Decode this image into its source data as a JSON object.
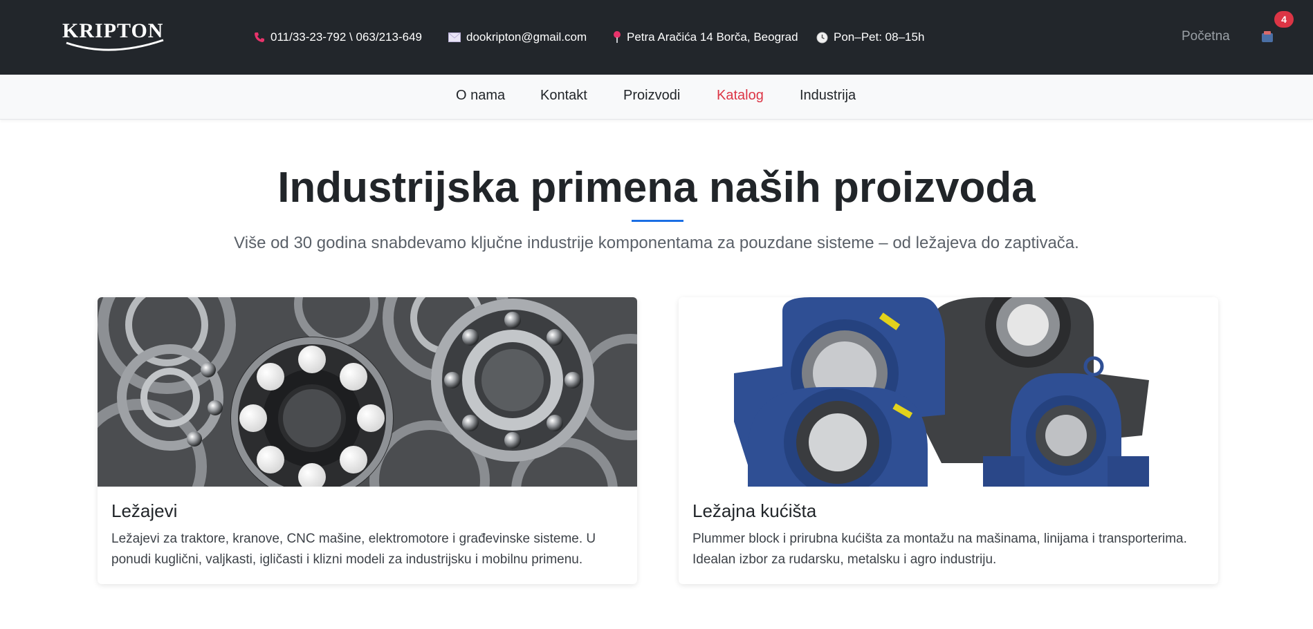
{
  "brand": {
    "logo_text": "KRIPTON"
  },
  "topbar": {
    "phone": "011/33-23-792 \\ 063/213-649",
    "email": "dookripton@gmail.com",
    "address": "Petra Aračića 14 Borča, Beograd",
    "hours": "Pon–Pet: 08–15h",
    "home_link": "Početna",
    "cart_count": "4"
  },
  "nav": {
    "items": [
      {
        "label": "O nama"
      },
      {
        "label": "Kontakt"
      },
      {
        "label": "Proizvodi"
      },
      {
        "label": "Katalog"
      },
      {
        "label": "Industrija"
      }
    ],
    "active_index": 3
  },
  "hero": {
    "title": "Industrijska primena naših proizvoda",
    "subtitle": "Više od 30 godina snabdevamo ključne industrije komponentama za pouzdane sisteme – od ležajeva do zaptivača."
  },
  "cards": [
    {
      "title": "Ležajevi",
      "text": "Ležajevi za traktore, kranove, CNC mašine, elektromotore i građevinske sisteme. U ponudi kuglični, valjkasti, igličasti i klizni modeli za industrijsku i mobilnu primenu."
    },
    {
      "title": "Ležajna kućišta",
      "text": "Plummer block i prirubna kućišta za montažu na mašinama, linijama i transporterima. Idealan izbor za rudarsku, metalsku i agro industriju."
    }
  ],
  "colors": {
    "topbar_bg": "#22262b",
    "accent_red": "#dc3545",
    "accent_blue": "#1b6ee4",
    "housing_blue": "#2c4a8c"
  }
}
